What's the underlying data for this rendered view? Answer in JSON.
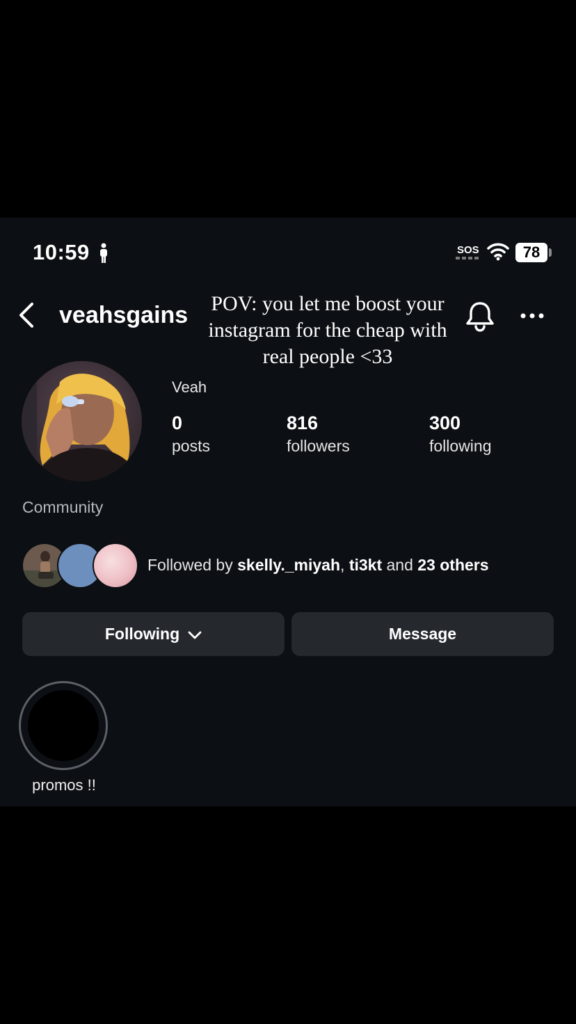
{
  "status_bar": {
    "time": "10:59",
    "carrier": "SOS",
    "battery": "78"
  },
  "header": {
    "username": "veahsgains",
    "caption_overlay": "POV: you let me boost your instagram for the cheap with real people <33"
  },
  "profile": {
    "display_name": "Veah",
    "category": "Community",
    "stats": {
      "posts_count": "0",
      "posts_label": "posts",
      "followers_count": "816",
      "followers_label": "followers",
      "following_count": "300",
      "following_label": "following"
    }
  },
  "followed_by": {
    "prefix": "Followed by ",
    "user1": "skelly._miyah",
    "separator": ", ",
    "user2": "ti3kt",
    "connector": " and ",
    "others": "23 others"
  },
  "actions": {
    "following_label": "Following",
    "message_label": "Message"
  },
  "highlights": [
    {
      "label": "promos !!"
    }
  ],
  "icons": {
    "back": "chevron-left-icon",
    "notifications": "bell-icon",
    "more": "more-horizontal-icon",
    "wifi": "wifi-icon",
    "person": "person-icon",
    "dropdown": "chevron-down-icon"
  },
  "colors": {
    "background": "#0c0f13",
    "button": "#25292e",
    "mini_avatar_blue": "#6d8fbe",
    "mini_avatar_pink": "#eebfc5"
  }
}
